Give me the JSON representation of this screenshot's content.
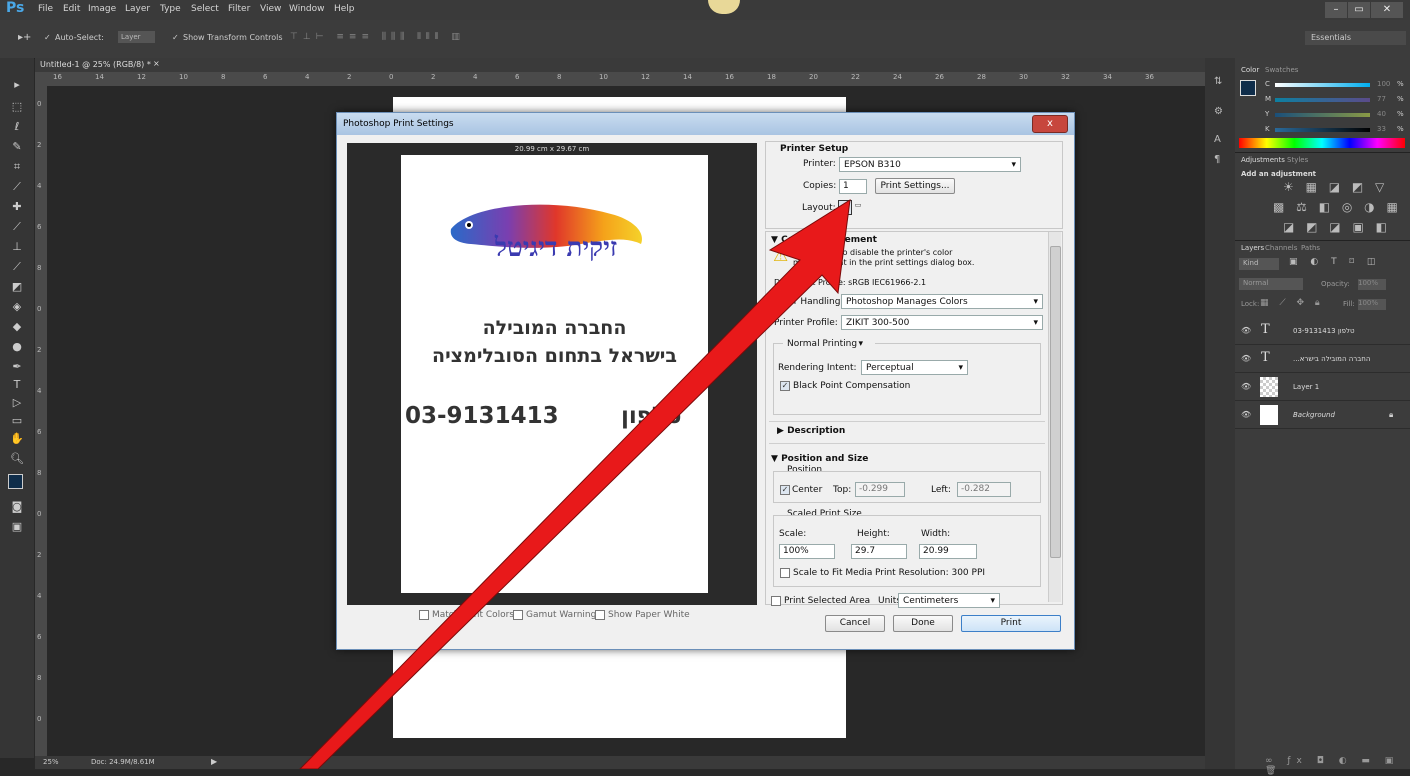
{
  "menubar": {
    "logo": "Ps",
    "items": [
      "File",
      "Edit",
      "Image",
      "Layer",
      "Type",
      "Select",
      "Filter",
      "View",
      "Window",
      "Help"
    ]
  },
  "window_controls": {
    "minimize": "–",
    "restore": "▭",
    "close": "✕"
  },
  "optionsbar": {
    "auto_select_label": "Auto-Select:",
    "auto_select_value": "Layer",
    "show_transform_label": "Show Transform Controls",
    "workspace": "Essentials"
  },
  "doc": {
    "tab_title": "Untitled-1 @ 25% (RGB/8) *",
    "zoom": "25%",
    "doc_size": "Doc: 24.9M/8.61M",
    "ruler_h": [
      "16",
      "14",
      "12",
      "10",
      "8",
      "6",
      "4",
      "2",
      "0",
      "2",
      "4",
      "6",
      "8",
      "10",
      "12",
      "14",
      "16",
      "18",
      "20",
      "22",
      "24",
      "26",
      "28",
      "30",
      "32",
      "34",
      "36"
    ],
    "ruler_v": [
      "0",
      "2",
      "4",
      "6",
      "8",
      "0",
      "2",
      "4",
      "6",
      "8",
      "0",
      "2",
      "4",
      "6",
      "8",
      "0",
      "2"
    ]
  },
  "panels": {
    "color_tabs": [
      "Color",
      "Swatches"
    ],
    "color_rows": [
      {
        "label": "C",
        "value": "100",
        "unit": "%"
      },
      {
        "label": "M",
        "value": "77",
        "unit": "%"
      },
      {
        "label": "Y",
        "value": "40",
        "unit": "%"
      },
      {
        "label": "K",
        "value": "33",
        "unit": "%"
      }
    ],
    "adjustments_tabs": [
      "Adjustments",
      "Styles"
    ],
    "adjustments_title": "Add an adjustment",
    "layers_tabs": [
      "Layers",
      "Channels",
      "Paths"
    ],
    "kind_label": "Kind",
    "blend_mode": "Normal",
    "opacity_label": "Opacity:",
    "opacity_value": "100%",
    "lock_label": "Lock:",
    "fill_label": "Fill:",
    "fill_value": "100%",
    "layers": [
      {
        "type": "T",
        "name": "03-9131413 טלפון"
      },
      {
        "type": "T",
        "name": "...החברה המובילה בישרא"
      },
      {
        "type": "img",
        "name": "Layer 1"
      },
      {
        "type": "bg",
        "name": "Background"
      }
    ]
  },
  "dialog": {
    "title": "Photoshop Print Settings",
    "close": "x",
    "paper_size": "20.99 cm x 29.67 cm",
    "logo_text": "זיקית דיגיטל",
    "page_line1": "החברה המובילה",
    "page_line2": "בישראל בתחום הסובלימציה",
    "page_phone": "03-9131413",
    "page_phone_label": "טלפון",
    "preview_options": [
      "Match Print Colors",
      "Gamut Warning",
      "Show Paper White"
    ],
    "printer_setup": {
      "title": "Printer Setup",
      "printer_label": "Printer:",
      "printer_value": "EPSON B310",
      "copies_label": "Copies:",
      "copies_value": "1",
      "print_settings_btn": "Print Settings...",
      "layout_label": "Layout:"
    },
    "color_management": {
      "title": "Color Management",
      "warning_line1": "Remember to disable the printer's color",
      "warning_line2": "management in the print settings dialog box.",
      "doc_profile": "Document Profile: sRGB IEC61966-2.1",
      "color_handling_label": "Color Handling:",
      "color_handling_value": "Photoshop Manages Colors",
      "printer_profile_label": "Printer Profile:",
      "printer_profile_value": "ZIKIT 300-500",
      "normal_printing": "Normal Printing",
      "rendering_intent_label": "Rendering Intent:",
      "rendering_intent_value": "Perceptual",
      "bpc_label": "Black Point Compensation"
    },
    "description_title": "Description",
    "position_size": {
      "title": "Position and Size",
      "position_label": "Position",
      "center_label": "Center",
      "top_label": "Top:",
      "top_value": "-0.299",
      "left_label": "Left:",
      "left_value": "-0.282",
      "scaled_label": "Scaled Print Size",
      "scale_label": "Scale:",
      "scale_value": "100%",
      "height_label": "Height:",
      "height_value": "29.7",
      "width_label": "Width:",
      "width_value": "20.99",
      "fit_label": "Scale to Fit Media",
      "resolution": "Print Resolution: 300 PPI"
    },
    "print_selected_label": "Print Selected Area",
    "units_label": "Units:",
    "units_value": "Centimeters",
    "buttons": {
      "cancel": "Cancel",
      "done": "Done",
      "print": "Print"
    }
  },
  "annotation": {
    "arrow_color": "#e8191a"
  }
}
